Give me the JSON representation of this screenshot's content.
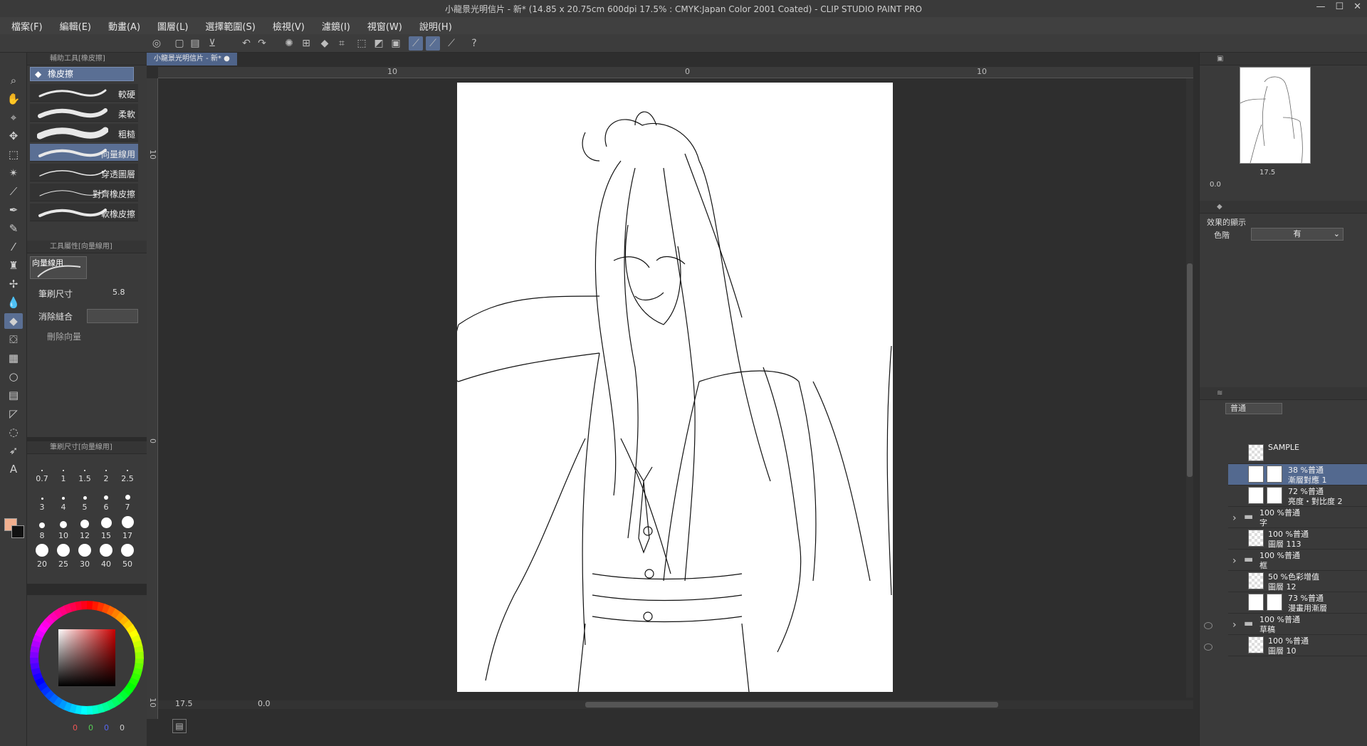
{
  "window": {
    "title": "小龍景光明信片 - 新* (14.85 x 20.75cm 600dpi 17.5% : CMYK:Japan Color 2001 Coated) - CLIP STUDIO PAINT PRO"
  },
  "menu": [
    "檔案(F)",
    "編輯(E)",
    "動畫(A)",
    "圖層(L)",
    "選擇範圍(S)",
    "檢視(V)",
    "濾鏡(I)",
    "視窗(W)",
    "說明(H)"
  ],
  "subtool": {
    "header": "輔助工具[橡皮擦]",
    "group": "橡皮擦",
    "brushes": [
      "較硬",
      "柔軟",
      "粗糙",
      "向量線用",
      "穿透圖層",
      "對齊橡皮擦",
      "軟橡皮擦"
    ],
    "selected_index": 3
  },
  "tool_property": {
    "header": "工具屬性[向量線用]",
    "preview_label": "向量線用",
    "brush_size_label": "筆刷尺寸",
    "brush_size_value": "5.8",
    "erase_label": "消除縫合",
    "delete_vector_label": "刪除向量"
  },
  "brush_size_panel": {
    "header": "筆刷尺寸[向量線用]",
    "sizes": [
      "0.7",
      "1",
      "1.5",
      "2",
      "2.5",
      "3",
      "4",
      "5",
      "6",
      "7",
      "8",
      "10",
      "12",
      "15",
      "17",
      "20",
      "25",
      "30",
      "40",
      "50"
    ]
  },
  "color": {
    "main": "#f2b08f",
    "sub": "#1a1a1a",
    "rgb": [
      "0",
      "0",
      "0",
      "0"
    ]
  },
  "document": {
    "tab_label": "小龍景光明信片 - 新*",
    "ruler_labels": [
      "10",
      "0",
      "10"
    ],
    "v_ruler_labels": [
      "10",
      "0",
      "10"
    ],
    "zoom": "17.5",
    "rotation": "0.0"
  },
  "navigator": {
    "zoom": "17.5",
    "rotation": "0.0"
  },
  "layer_property": {
    "effect_title": "效果的顯示",
    "tone_label": "色階",
    "tone_value": "有"
  },
  "layers_panel": {
    "blend_mode": "普通",
    "layers": [
      {
        "mode": "SAMPLE",
        "name": "",
        "selected": false,
        "kind": "plain"
      },
      {
        "mode": "38 %普通",
        "name": "漸層對應 1",
        "selected": true,
        "kind": "adjust"
      },
      {
        "mode": "72 %普通",
        "name": "亮度・對比度 2",
        "selected": false,
        "kind": "adjust"
      },
      {
        "mode": "100 %普通",
        "name": "字",
        "selected": false,
        "kind": "folder"
      },
      {
        "mode": "100 %普通",
        "name": "圖層 113",
        "selected": false,
        "kind": "plain"
      },
      {
        "mode": "100 %普通",
        "name": "框",
        "selected": false,
        "kind": "folder"
      },
      {
        "mode": "50 %色彩增值",
        "name": "圖層 12",
        "selected": false,
        "kind": "plain"
      },
      {
        "mode": "73 %普通",
        "name": "漫畫用漸層",
        "selected": false,
        "kind": "mask"
      },
      {
        "mode": "100 %普通",
        "name": "草稿",
        "selected": false,
        "kind": "folder"
      },
      {
        "mode": "100 %普通",
        "name": "圖層 10",
        "selected": false,
        "kind": "plain"
      }
    ]
  }
}
